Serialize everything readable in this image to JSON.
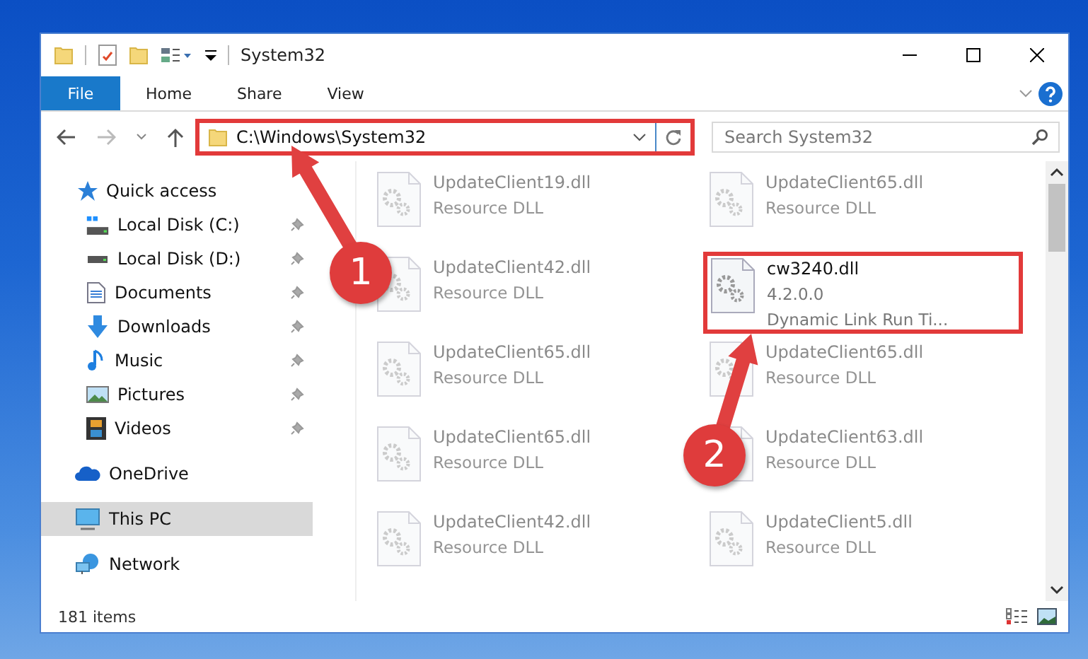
{
  "window": {
    "title": "System32"
  },
  "ribbon_tabs": [
    {
      "label": "File",
      "selected": true
    },
    {
      "label": "Home",
      "selected": false
    },
    {
      "label": "Share",
      "selected": false
    },
    {
      "label": "View",
      "selected": false
    }
  ],
  "address_bar": {
    "path": "C:\\Windows\\System32",
    "highlighted": true
  },
  "search": {
    "placeholder": "Search System32"
  },
  "sidebar": {
    "items": [
      {
        "kind": "section",
        "label": "Quick access",
        "selected": false
      },
      {
        "kind": "pinned",
        "label": "Local Disk (C:)",
        "selected": false
      },
      {
        "kind": "pinned",
        "label": "Local Disk (D:)",
        "selected": false
      },
      {
        "kind": "pinned",
        "label": "Documents",
        "selected": false
      },
      {
        "kind": "pinned",
        "label": "Downloads",
        "selected": false
      },
      {
        "kind": "pinned",
        "label": "Music",
        "selected": false
      },
      {
        "kind": "pinned",
        "label": "Pictures",
        "selected": false
      },
      {
        "kind": "pinned",
        "label": "Videos",
        "selected": false
      },
      {
        "kind": "section",
        "label": "OneDrive",
        "selected": false
      },
      {
        "kind": "section",
        "label": "This PC",
        "selected": true
      },
      {
        "kind": "section",
        "label": "Network",
        "selected": false
      }
    ]
  },
  "files": [
    {
      "name": "UpdateClient19.dll",
      "details": [
        "Resource DLL"
      ],
      "blurred": true,
      "highlighted": false
    },
    {
      "name": "UpdateClient65.dll",
      "details": [
        "Resource DLL"
      ],
      "blurred": true,
      "highlighted": false
    },
    {
      "name": "UpdateClient42.dll",
      "details": [
        "Resource DLL"
      ],
      "blurred": true,
      "highlighted": false
    },
    {
      "name": "cw3240.dll",
      "details": [
        "4.2.0.0",
        "Dynamic Link Run Ti..."
      ],
      "blurred": false,
      "highlighted": true
    },
    {
      "name": "UpdateClient65.dll",
      "details": [
        "Resource DLL"
      ],
      "blurred": true,
      "highlighted": false
    },
    {
      "name": "UpdateClient65.dll",
      "details": [
        "Resource DLL"
      ],
      "blurred": true,
      "highlighted": false
    },
    {
      "name": "UpdateClient65.dll",
      "details": [
        "Resource DLL"
      ],
      "blurred": true,
      "highlighted": false
    },
    {
      "name": "UpdateClient63.dll",
      "details": [
        "Resource DLL"
      ],
      "blurred": true,
      "highlighted": false
    },
    {
      "name": "UpdateClient42.dll",
      "details": [
        "Resource DLL"
      ],
      "blurred": true,
      "highlighted": false
    },
    {
      "name": "UpdateClient5.dll",
      "details": [
        "Resource DLL"
      ],
      "blurred": true,
      "highlighted": false
    }
  ],
  "status_bar": {
    "item_count": "181 items"
  },
  "callouts": [
    {
      "number": "1"
    },
    {
      "number": "2"
    }
  ]
}
